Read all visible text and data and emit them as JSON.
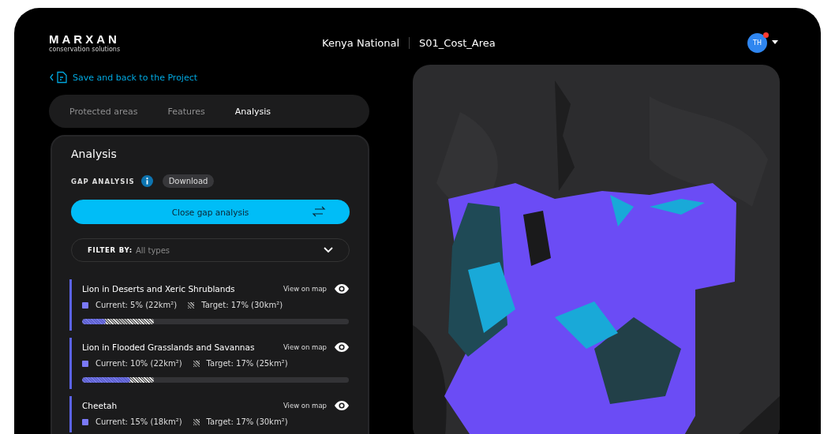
{
  "logo": {
    "name": "MARXAN",
    "tagline": "conservation solutions"
  },
  "header": {
    "project": "Kenya National",
    "scenario": "S01_Cost_Area",
    "avatar": {
      "initials": "TH",
      "notification": true
    }
  },
  "back_link": "Save and back to the Project",
  "tabs": [
    {
      "label": "Protected areas",
      "selected": false
    },
    {
      "label": "Features",
      "selected": false
    },
    {
      "label": "Analysis",
      "selected": true
    }
  ],
  "panel": {
    "title": "Analysis",
    "section": "GAP ANALYSIS",
    "download": "Download",
    "close_button": "Close gap analysis",
    "filter": {
      "label": "FILTER BY:",
      "value": "All types"
    },
    "features": [
      {
        "name": "Lion in Deserts and Xeric Shrublands",
        "view": "View on map",
        "current": {
          "text": "Current: 5% (22km²)",
          "level": 0.09
        },
        "target": {
          "text": "Target: 17% (30km²)",
          "level": 0.27
        }
      },
      {
        "name": "Lion in Flooded Grasslands and Savannas",
        "view": "View on map",
        "current": {
          "text": "Current: 10% (22km²)",
          "level": 0.18
        },
        "target": {
          "text": "Target: 17% (25km²)",
          "level": 0.27
        }
      },
      {
        "name": "Cheetah",
        "view": "View on map",
        "current": {
          "text": "Current: 15% (18km²)"
        },
        "target": {
          "text": "Target: 17% (30km²)"
        }
      }
    ]
  }
}
